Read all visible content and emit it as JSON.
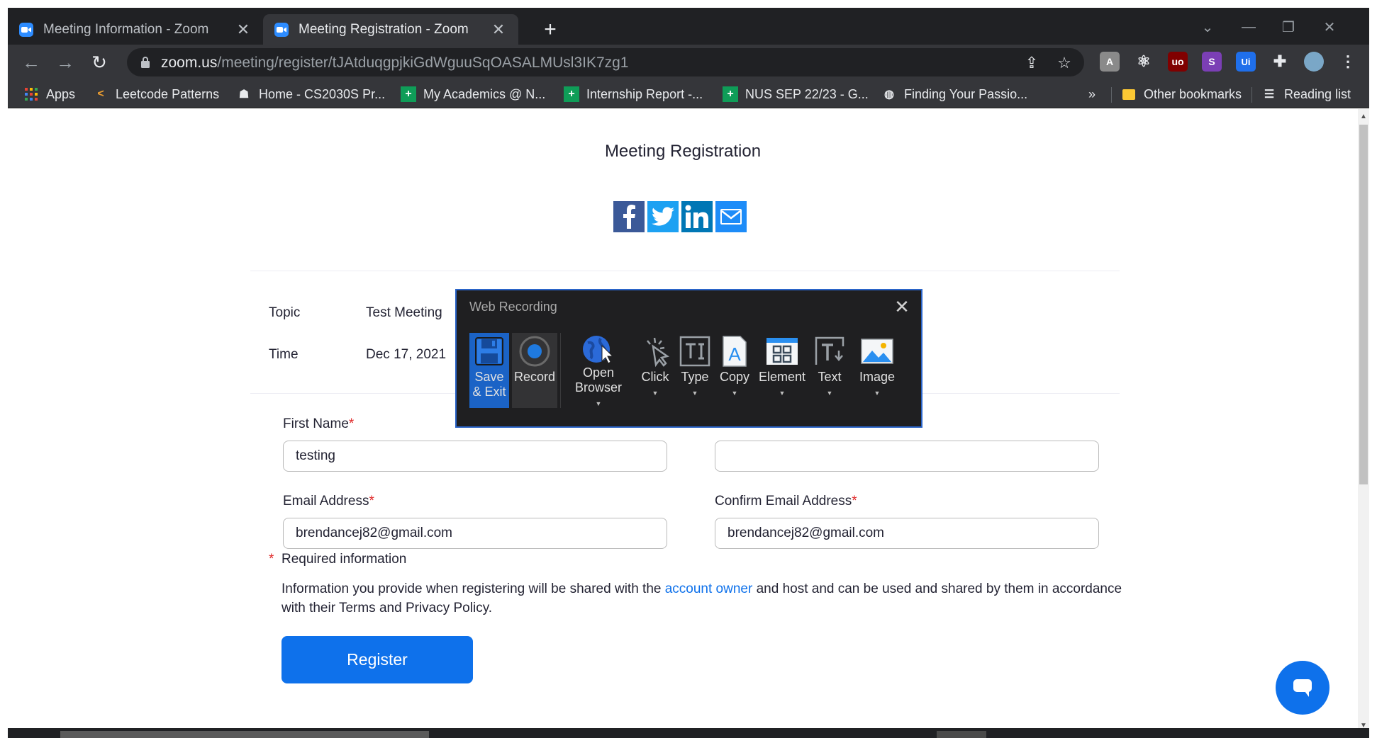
{
  "browser": {
    "tabs": [
      {
        "title": "Meeting Information - Zoom",
        "active": false
      },
      {
        "title": "Meeting Registration - Zoom",
        "active": true
      }
    ],
    "url_host": "zoom.us",
    "url_path": "/meeting/register/tJAtduqgpjkiGdWguuSqOASALMUsl3IK7zg1",
    "bookmarks": [
      {
        "label": "Apps",
        "icon": "apps-grid-icon"
      },
      {
        "label": "Leetcode Patterns",
        "icon": "leetcode-icon"
      },
      {
        "label": "Home - CS2030S Pr...",
        "icon": "home-page-icon"
      },
      {
        "label": "My Academics @ N...",
        "icon": "sheets-icon"
      },
      {
        "label": "Internship Report -...",
        "icon": "sheets-icon"
      },
      {
        "label": "NUS SEP 22/23 - G...",
        "icon": "sheets-icon"
      },
      {
        "label": "Finding Your Passio...",
        "icon": "globe-icon"
      }
    ],
    "more_bookmarks": "»",
    "other_bookmarks": "Other bookmarks",
    "reading_list": "Reading list"
  },
  "page": {
    "title": "Meeting Registration",
    "social": [
      "facebook-icon",
      "twitter-icon",
      "linkedin-icon",
      "email-icon"
    ],
    "topic_label": "Topic",
    "topic_value": "Test Meeting",
    "time_label": "Time",
    "time_value": "Dec 17, 2021",
    "first_name_label": "First Name",
    "first_name_value": "testing",
    "last_name_value": "",
    "email_label": "Email Address",
    "email_value": "brendancej82@gmail.com",
    "confirm_email_label": "Confirm Email Address",
    "confirm_email_value": "brendancej82@gmail.com",
    "required_star": "*",
    "required_note": "Required information",
    "disclaimer_before": "Information you provide when registering will be shared with the ",
    "disclaimer_link": "account owner",
    "disclaimer_after": " and host and can be used and shared by them in accordance with their Terms and Privacy Policy.",
    "register_label": "Register"
  },
  "recorder": {
    "title": "Web Recording",
    "buttons": {
      "save": "Save & Exit",
      "record": "Record",
      "open_browser": "Open Browser",
      "click": "Click",
      "type": "Type",
      "copy": "Copy",
      "element": "Element",
      "text": "Text",
      "image": "Image"
    }
  },
  "colors": {
    "zoom_blue": "#0e71eb",
    "facebook": "#3b5998",
    "twitter": "#1da1f2",
    "linkedin": "#0077b5",
    "required": "#e02828",
    "recorder_bg": "#1f1f21",
    "recorder_save": "#1b63c6"
  }
}
